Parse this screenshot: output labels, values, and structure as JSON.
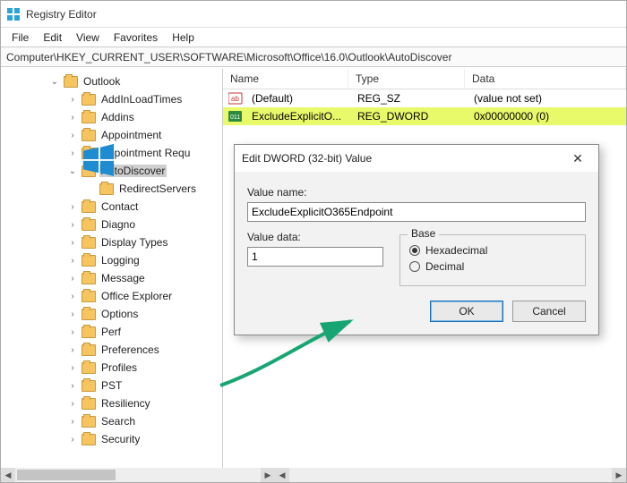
{
  "window": {
    "title": "Registry Editor"
  },
  "menu": {
    "file": "File",
    "edit": "Edit",
    "view": "View",
    "favorites": "Favorites",
    "help": "Help"
  },
  "address": "Computer\\HKEY_CURRENT_USER\\SOFTWARE\\Microsoft\\Office\\16.0\\Outlook\\AutoDiscover",
  "tree": {
    "root": "Outlook",
    "items": [
      "AddInLoadTimes",
      "Addins",
      "Appointment",
      "Appointment Requ",
      "AutoDiscover",
      "RedirectServers",
      "Contact",
      "Diagno",
      "Display Types",
      "Logging",
      "Message",
      "Office Explorer",
      "Options",
      "Perf",
      "Preferences",
      "Profiles",
      "PST",
      "Resiliency",
      "Search",
      "Security"
    ],
    "selected": "AutoDiscover"
  },
  "columns": {
    "name": "Name",
    "type": "Type",
    "data": "Data"
  },
  "rows": [
    {
      "name": "(Default)",
      "type": "REG_SZ",
      "data": "(value not set)",
      "hl": false,
      "icon": "ab"
    },
    {
      "name": "ExcludeExplicitO...",
      "type": "REG_DWORD",
      "data": "0x00000000 (0)",
      "hl": true,
      "icon": "dw"
    }
  ],
  "dialog": {
    "title": "Edit DWORD (32-bit) Value",
    "value_name_label": "Value name:",
    "value_name": "ExcludeExplicitO365Endpoint",
    "value_data_label": "Value data:",
    "value_data": "1",
    "base_label": "Base",
    "hex": "Hexadecimal",
    "dec": "Decimal",
    "ok": "OK",
    "cancel": "Cancel"
  }
}
